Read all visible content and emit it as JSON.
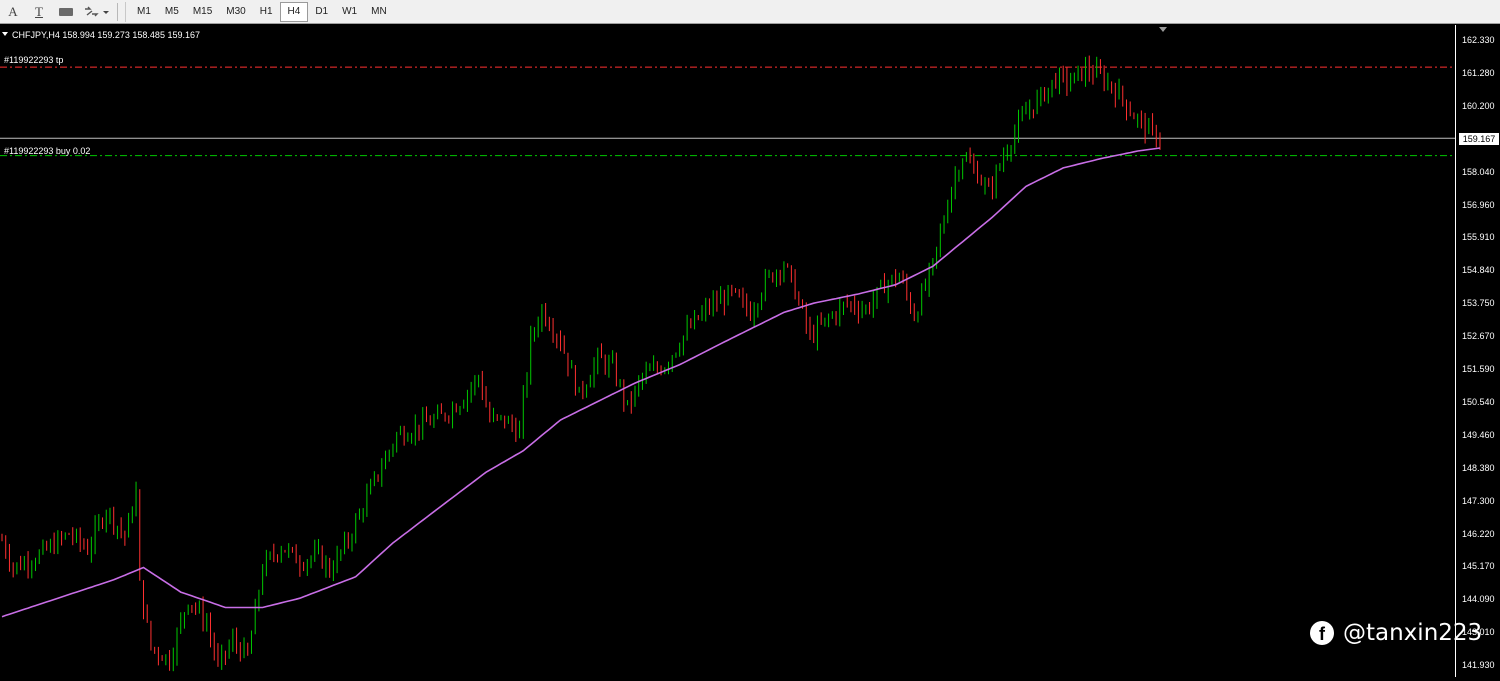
{
  "toolbar": {
    "icons": [
      "text-A-icon",
      "text-T-icon",
      "label-icon",
      "shapes-icon"
    ],
    "text_a": "A",
    "text_t": "T",
    "timeframes": [
      "M1",
      "M5",
      "M15",
      "M30",
      "H1",
      "H4",
      "D1",
      "W1",
      "MN"
    ],
    "active_timeframe": "H4"
  },
  "chart_header": {
    "symbol_info": "CHFJPY,H4  158.994 159.273 158.485 159.167"
  },
  "orders": {
    "tp_label": "#119922293 tp",
    "buy_label": "#119922293 buy 0.02"
  },
  "current_price": "159.167",
  "price_axis": [
    "162.330",
    "161.280",
    "160.200",
    "159.167",
    "158.040",
    "156.960",
    "155.910",
    "154.840",
    "153.750",
    "152.670",
    "151.590",
    "150.540",
    "149.460",
    "148.380",
    "147.300",
    "146.220",
    "145.170",
    "144.090",
    "143.010",
    "141.930"
  ],
  "watermark": {
    "handle": "@tanxin223"
  },
  "colors": {
    "bull": "#00c800",
    "bear": "#ff3030",
    "ma": "#c86ee6",
    "tp_line": "#ff3030",
    "entry_line": "#00c800",
    "price_line": "#c0c0c0"
  },
  "chart_data": {
    "type": "line",
    "ylim": [
      141.5,
      162.8
    ],
    "tp_price": 161.48,
    "entry_price": 158.6,
    "current_price": 159.167,
    "close_path": [
      {
        "i": 0,
        "y": 146.1
      },
      {
        "i": 3,
        "y": 145.2
      },
      {
        "i": 10,
        "y": 145.6
      },
      {
        "i": 18,
        "y": 146.3
      },
      {
        "i": 23,
        "y": 145.8
      },
      {
        "i": 28,
        "y": 147.1
      },
      {
        "i": 33,
        "y": 146.2
      },
      {
        "i": 36,
        "y": 147.6
      },
      {
        "i": 37,
        "y": 144.6
      },
      {
        "i": 40,
        "y": 142.6
      },
      {
        "i": 45,
        "y": 142.2
      },
      {
        "i": 50,
        "y": 144.2
      },
      {
        "i": 55,
        "y": 143.4
      },
      {
        "i": 58,
        "y": 142.0
      },
      {
        "i": 62,
        "y": 142.8
      },
      {
        "i": 66,
        "y": 142.3
      },
      {
        "i": 70,
        "y": 145.2
      },
      {
        "i": 75,
        "y": 145.9
      },
      {
        "i": 80,
        "y": 145.4
      },
      {
        "i": 85,
        "y": 145.6
      },
      {
        "i": 88,
        "y": 145.1
      },
      {
        "i": 93,
        "y": 146.1
      },
      {
        "i": 97,
        "y": 147.2
      },
      {
        "i": 100,
        "y": 148.0
      },
      {
        "i": 106,
        "y": 149.5
      },
      {
        "i": 112,
        "y": 149.8
      },
      {
        "i": 118,
        "y": 150.1
      },
      {
        "i": 123,
        "y": 150.6
      },
      {
        "i": 128,
        "y": 151.4
      },
      {
        "i": 131,
        "y": 150.0
      },
      {
        "i": 135,
        "y": 150.0
      },
      {
        "i": 139,
        "y": 149.6
      },
      {
        "i": 142,
        "y": 152.6
      },
      {
        "i": 145,
        "y": 153.6
      },
      {
        "i": 150,
        "y": 152.6
      },
      {
        "i": 155,
        "y": 150.8
      },
      {
        "i": 160,
        "y": 152.0
      },
      {
        "i": 164,
        "y": 151.7
      },
      {
        "i": 168,
        "y": 150.4
      },
      {
        "i": 172,
        "y": 151.4
      },
      {
        "i": 178,
        "y": 151.8
      },
      {
        "i": 184,
        "y": 152.9
      },
      {
        "i": 190,
        "y": 153.7
      },
      {
        "i": 196,
        "y": 154.1
      },
      {
        "i": 201,
        "y": 153.5
      },
      {
        "i": 205,
        "y": 154.5
      },
      {
        "i": 210,
        "y": 155.1
      },
      {
        "i": 213,
        "y": 154.2
      },
      {
        "i": 217,
        "y": 152.7
      },
      {
        "i": 222,
        "y": 153.3
      },
      {
        "i": 227,
        "y": 153.8
      },
      {
        "i": 232,
        "y": 153.6
      },
      {
        "i": 237,
        "y": 154.4
      },
      {
        "i": 241,
        "y": 154.7
      },
      {
        "i": 245,
        "y": 153.4
      },
      {
        "i": 250,
        "y": 155.0
      },
      {
        "i": 255,
        "y": 157.6
      },
      {
        "i": 258,
        "y": 158.6
      },
      {
        "i": 262,
        "y": 158.0
      },
      {
        "i": 265,
        "y": 157.4
      },
      {
        "i": 270,
        "y": 158.9
      },
      {
        "i": 275,
        "y": 160.0
      },
      {
        "i": 279,
        "y": 160.5
      },
      {
        "i": 283,
        "y": 161.1
      },
      {
        "i": 287,
        "y": 161.0
      },
      {
        "i": 291,
        "y": 161.4
      },
      {
        "i": 295,
        "y": 161.2
      },
      {
        "i": 300,
        "y": 160.6
      },
      {
        "i": 304,
        "y": 159.9
      },
      {
        "i": 308,
        "y": 159.4
      },
      {
        "i": 311,
        "y": 159.167
      }
    ],
    "ma_path": [
      {
        "i": 0,
        "y": 143.6
      },
      {
        "i": 15,
        "y": 144.2
      },
      {
        "i": 30,
        "y": 144.8
      },
      {
        "i": 38,
        "y": 145.2
      },
      {
        "i": 48,
        "y": 144.4
      },
      {
        "i": 60,
        "y": 143.9
      },
      {
        "i": 70,
        "y": 143.9
      },
      {
        "i": 80,
        "y": 144.2
      },
      {
        "i": 95,
        "y": 144.9
      },
      {
        "i": 105,
        "y": 146.0
      },
      {
        "i": 118,
        "y": 147.2
      },
      {
        "i": 130,
        "y": 148.3
      },
      {
        "i": 140,
        "y": 149.0
      },
      {
        "i": 150,
        "y": 150.0
      },
      {
        "i": 160,
        "y": 150.6
      },
      {
        "i": 170,
        "y": 151.2
      },
      {
        "i": 182,
        "y": 151.8
      },
      {
        "i": 195,
        "y": 152.6
      },
      {
        "i": 210,
        "y": 153.5
      },
      {
        "i": 218,
        "y": 153.8
      },
      {
        "i": 230,
        "y": 154.1
      },
      {
        "i": 240,
        "y": 154.4
      },
      {
        "i": 250,
        "y": 155.0
      },
      {
        "i": 258,
        "y": 155.8
      },
      {
        "i": 266,
        "y": 156.6
      },
      {
        "i": 275,
        "y": 157.6
      },
      {
        "i": 285,
        "y": 158.2
      },
      {
        "i": 295,
        "y": 158.5
      },
      {
        "i": 305,
        "y": 158.75
      },
      {
        "i": 311,
        "y": 158.85
      }
    ],
    "bars": 312
  }
}
